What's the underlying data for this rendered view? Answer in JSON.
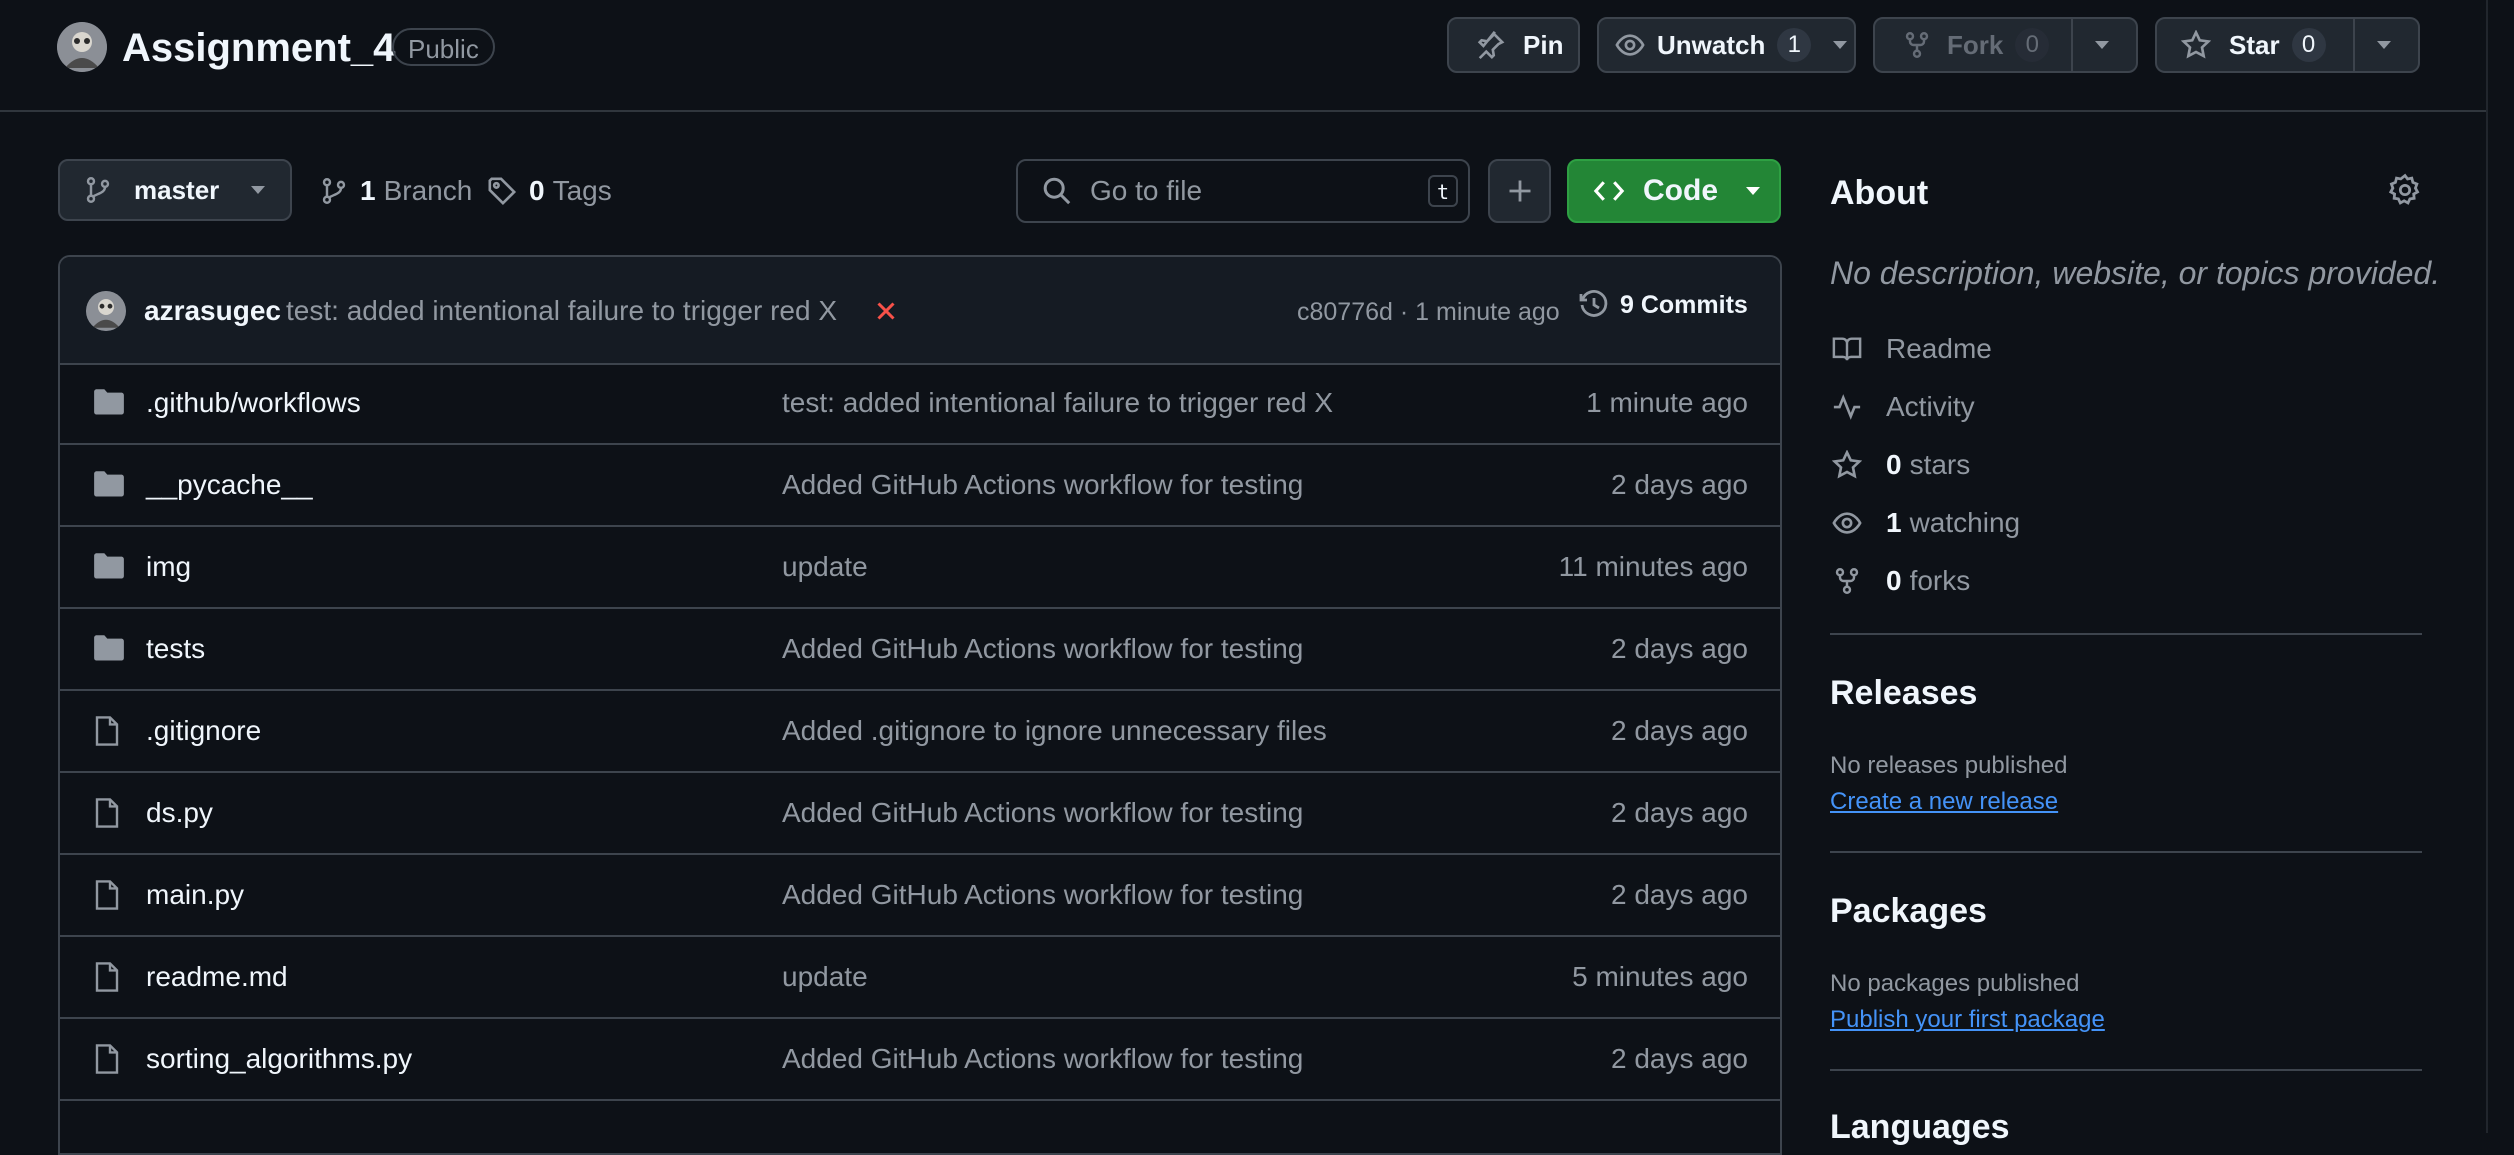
{
  "header": {
    "repo_name": "Assignment_4",
    "visibility": "Public",
    "pin_label": "Pin",
    "unwatch_label": "Unwatch",
    "watch_count": "1",
    "fork_label": "Fork",
    "fork_count": "0",
    "star_label": "Star",
    "star_count": "0"
  },
  "toolbar": {
    "branch": "master",
    "branches_count": "1",
    "branches_label": "Branch",
    "tags_count": "0",
    "tags_label": "Tags",
    "search_placeholder": "Go to file",
    "search_shortcut": "t",
    "code_label": "Code"
  },
  "latest_commit": {
    "author": "azrasugec",
    "message": "test: added intentional failure to trigger red X",
    "status_icon": "x-icon",
    "hash_time": "c80776d · 1 minute ago",
    "commits_label": "9 Commits"
  },
  "files": [
    {
      "type": "folder",
      "name": ".github/workflows",
      "message": "test: added intentional failure to trigger red X",
      "time": "1 minute ago"
    },
    {
      "type": "folder",
      "name": "__pycache__",
      "message": "Added GitHub Actions workflow for testing",
      "time": "2 days ago"
    },
    {
      "type": "folder",
      "name": "img",
      "message": "update",
      "time": "11 minutes ago"
    },
    {
      "type": "folder",
      "name": "tests",
      "message": "Added GitHub Actions workflow for testing",
      "time": "2 days ago"
    },
    {
      "type": "file",
      "name": ".gitignore",
      "message": "Added .gitignore to ignore unnecessary files",
      "time": "2 days ago"
    },
    {
      "type": "file",
      "name": "ds.py",
      "message": "Added GitHub Actions workflow for testing",
      "time": "2 days ago"
    },
    {
      "type": "file",
      "name": "main.py",
      "message": "Added GitHub Actions workflow for testing",
      "time": "2 days ago"
    },
    {
      "type": "file",
      "name": "readme.md",
      "message": "update",
      "time": "5 minutes ago"
    },
    {
      "type": "file",
      "name": "sorting_algorithms.py",
      "message": "Added GitHub Actions workflow for testing",
      "time": "2 days ago"
    }
  ],
  "about": {
    "title": "About",
    "description": "No description, website, or topics provided.",
    "readme": "Readme",
    "activity": "Activity",
    "stars_count": "0",
    "stars_label": "stars",
    "watching_count": "1",
    "watching_label": "watching",
    "forks_count": "0",
    "forks_label": "forks"
  },
  "releases": {
    "title": "Releases",
    "empty": "No releases published",
    "link": "Create a new release"
  },
  "packages": {
    "title": "Packages",
    "empty": "No packages published",
    "link": "Publish your first package"
  },
  "languages": {
    "title": "Languages"
  },
  "colors": {
    "background": "#0d1117",
    "accent_green": "#238636",
    "link_blue": "#4493f8",
    "fail_red": "#f85149",
    "border": "#3d444d",
    "muted_text": "#9198a1"
  }
}
